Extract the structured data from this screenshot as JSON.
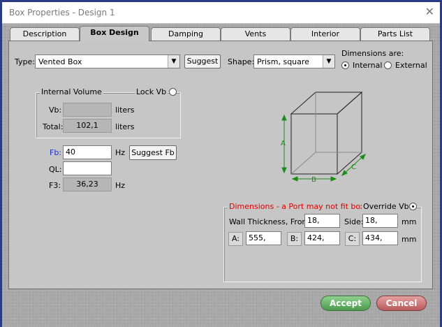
{
  "window": {
    "title": "Box Properties - Design 1"
  },
  "tabs": [
    {
      "label": "Description"
    },
    {
      "label": "Box Design"
    },
    {
      "label": "Damping"
    },
    {
      "label": "Vents"
    },
    {
      "label": "Interior"
    },
    {
      "label": "Parts List"
    }
  ],
  "type": {
    "label": "Type:",
    "value": "Vented Box",
    "suggest_label": "Suggest"
  },
  "shape": {
    "label": "Shape:",
    "value": "Prism, square"
  },
  "dimensions_are": {
    "label": "Dimensions are:",
    "internal_label": "Internal",
    "external_label": "External",
    "selected": "Internal"
  },
  "internal_volume": {
    "title": "Internal Volume",
    "lock_label": "Lock Vb",
    "vb_label": "Vb:",
    "vb_value": "",
    "vb_unit": "liters",
    "total_label": "Total:",
    "total_value": "102,1",
    "total_unit": "liters"
  },
  "fb": {
    "label": "Fb:",
    "value": "40",
    "unit": "Hz",
    "suggest_label": "Suggest Fb",
    "label_color": "#1a2fd6"
  },
  "ql": {
    "label": "QL:",
    "value": ""
  },
  "f3": {
    "label": "F3:",
    "value": "36,23",
    "unit": "Hz"
  },
  "diagram": {
    "a_label": "A",
    "b_label": "B",
    "c_label": "C"
  },
  "dimensions": {
    "warning": "Dimensions - a Port may not fit box.",
    "warning_color": "#e00000",
    "override_label": "Override Vb",
    "wall_label": "Wall Thickness, Front:",
    "front_value": "18,",
    "side_label": "Side:",
    "side_value": "18,",
    "unit": "mm",
    "a_label": "A:",
    "a_value": "555,",
    "b_label": "B:",
    "b_value": "424,",
    "c_label": "C:",
    "c_value": "434,"
  },
  "actions": {
    "accept_label": "Accept",
    "cancel_label": "Cancel"
  }
}
